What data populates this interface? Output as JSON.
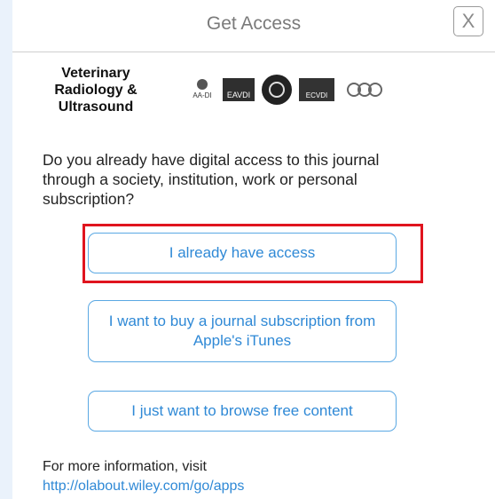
{
  "dialog": {
    "title": "Get Access",
    "close_label": "X"
  },
  "journal": {
    "name_line1": "Veterinary",
    "name_line2": "Radiology &",
    "name_line3": "Ultrasound",
    "logos": [
      "aavdi-logo",
      "eavdi-logo",
      "seal-logo",
      "ecvdi-logo",
      "globe-logo"
    ],
    "logo_texts": {
      "aa": "AA-DI",
      "eavdi": "EAVDI",
      "ecvdi": "ECVDI"
    }
  },
  "question": "Do you already have digital access to this journal through a society, institution, work or personal subscription?",
  "buttons": {
    "access": "I already have access",
    "buy": "I want to buy a journal subscription from Apple's iTunes",
    "browse": "I just want to browse free content"
  },
  "footer": {
    "text": "For more information, visit",
    "link": "http://olabout.wiley.com/go/apps"
  },
  "colors": {
    "accent": "#2f89d6",
    "highlight": "#e0141e",
    "background": "#eaf2fb"
  }
}
